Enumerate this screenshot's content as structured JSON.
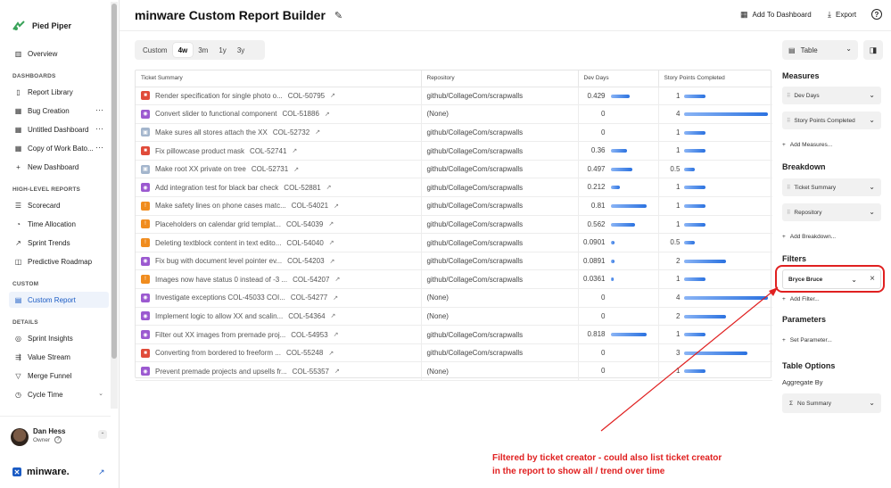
{
  "sidebar": {
    "brand": "Pied Piper",
    "overview": "Overview",
    "sections": {
      "dashboards": "DASHBOARDS",
      "high_level": "HIGH-LEVEL REPORTS",
      "custom": "CUSTOM",
      "details": "DETAILS"
    },
    "dashboards": [
      "Report Library",
      "Bug Creation",
      "Untitled Dashboard",
      "Copy of Work Bato...",
      "New Dashboard"
    ],
    "high_level": [
      "Scorecard",
      "Time Allocation",
      "Sprint Trends",
      "Predictive Roadmap"
    ],
    "custom": [
      "Custom Report"
    ],
    "details": [
      "Sprint Insights",
      "Value Stream",
      "Merge Funnel",
      "Cycle Time"
    ],
    "user": {
      "name": "Dan Hess",
      "role": "Owner"
    },
    "footer_brand": "minware."
  },
  "header": {
    "title": "minware Custom Report Builder",
    "add_dashboard": "Add To Dashboard",
    "export": "Export"
  },
  "periods": [
    "Custom",
    "4w",
    "3m",
    "1y",
    "3y"
  ],
  "active_period": "4w",
  "view_select": "Table",
  "table": {
    "columns": [
      "Ticket Summary",
      "Repository",
      "Dev Days",
      "Story Points Completed"
    ],
    "rows": [
      {
        "type": "bug",
        "summary": "Render specification for single photo o...",
        "key": "COL-50795",
        "repo": "github/CollageCom/scrapwalls",
        "dev": "0.429",
        "dev_v": 0.429,
        "sp": "1",
        "sp_v": 1
      },
      {
        "type": "story",
        "summary": "Convert slider to functional component",
        "key": "COL-51886",
        "repo": "(None)",
        "dev": "0",
        "dev_v": 0,
        "sp": "4",
        "sp_v": 4
      },
      {
        "type": "task",
        "summary": "Make sures all stores attach the XX",
        "key": "COL-52732",
        "repo": "github/CollageCom/scrapwalls",
        "dev": "0",
        "dev_v": 0,
        "sp": "1",
        "sp_v": 1
      },
      {
        "type": "bug",
        "summary": "Fix pillowcase product mask",
        "key": "COL-52741",
        "repo": "github/CollageCom/scrapwalls",
        "dev": "0.36",
        "dev_v": 0.36,
        "sp": "1",
        "sp_v": 1
      },
      {
        "type": "task",
        "summary": "Make root XX private on tree",
        "key": "COL-52731",
        "repo": "github/CollageCom/scrapwalls",
        "dev": "0.497",
        "dev_v": 0.497,
        "sp": "0.5",
        "sp_v": 0.5
      },
      {
        "type": "story",
        "summary": "Add integration test for black bar check",
        "key": "COL-52881",
        "repo": "github/CollageCom/scrapwalls",
        "dev": "0.212",
        "dev_v": 0.212,
        "sp": "1",
        "sp_v": 1
      },
      {
        "type": "warn",
        "summary": "Make safety lines on phone cases matc...",
        "key": "COL-54021",
        "repo": "github/CollageCom/scrapwalls",
        "dev": "0.81",
        "dev_v": 0.81,
        "sp": "1",
        "sp_v": 1
      },
      {
        "type": "warn",
        "summary": "Placeholders on calendar grid templat...",
        "key": "COL-54039",
        "repo": "github/CollageCom/scrapwalls",
        "dev": "0.562",
        "dev_v": 0.562,
        "sp": "1",
        "sp_v": 1
      },
      {
        "type": "warn",
        "summary": "Deleting textblock content in text edito...",
        "key": "COL-54040",
        "repo": "github/CollageCom/scrapwalls",
        "dev": "0.0901",
        "dev_v": 0.0901,
        "sp": "0.5",
        "sp_v": 0.5
      },
      {
        "type": "story",
        "summary": "Fix bug with document level pointer ev...",
        "key": "COL-54203",
        "repo": "github/CollageCom/scrapwalls",
        "dev": "0.0891",
        "dev_v": 0.0891,
        "sp": "2",
        "sp_v": 2
      },
      {
        "type": "warn",
        "summary": "Images now have status 0 instead of -3 ...",
        "key": "COL-54207",
        "repo": "github/CollageCom/scrapwalls",
        "dev": "0.0361",
        "dev_v": 0.0361,
        "sp": "1",
        "sp_v": 1
      },
      {
        "type": "story",
        "summary": "Investigate exceptions COL-45033 COI...",
        "key": "COL-54277",
        "repo": "(None)",
        "dev": "0",
        "dev_v": 0,
        "sp": "4",
        "sp_v": 4
      },
      {
        "type": "story",
        "summary": "Implement logic to allow XX and scalin...",
        "key": "COL-54364",
        "repo": "(None)",
        "dev": "0",
        "dev_v": 0,
        "sp": "2",
        "sp_v": 2
      },
      {
        "type": "story",
        "summary": "Filter out XX images from premade proj...",
        "key": "COL-54953",
        "repo": "github/CollageCom/scrapwalls",
        "dev": "0.818",
        "dev_v": 0.818,
        "sp": "1",
        "sp_v": 1
      },
      {
        "type": "bug",
        "summary": "Converting from bordered to freeform ...",
        "key": "COL-55248",
        "repo": "github/CollageCom/scrapwalls",
        "dev": "0",
        "dev_v": 0,
        "sp": "3",
        "sp_v": 3
      },
      {
        "type": "story",
        "summary": "Prevent premade projects and upsells fr...",
        "key": "COL-55357",
        "repo": "(None)",
        "dev": "0",
        "dev_v": 0,
        "sp": "1",
        "sp_v": 1
      }
    ],
    "dev_max": 0.818,
    "sp_max": 4
  },
  "panel": {
    "measures": "Measures",
    "measure_fields": [
      "Dev Days",
      "Story Points Completed"
    ],
    "add_measures": "Add Measures...",
    "breakdown": "Breakdown",
    "breakdown_fields": [
      "Ticket Summary",
      "Repository"
    ],
    "add_breakdown": "Add Breakdown...",
    "filters": "Filters",
    "filter_value": "Bryce Bruce",
    "add_filter": "Add Filter...",
    "parameters": "Parameters",
    "set_parameter": "Set Parameter...",
    "table_options": "Table Options",
    "aggregate_by": "Aggregate By",
    "aggregate_value": "No Summary"
  },
  "annotation": {
    "line1": "Filtered by ticket creator - could also list ticket creator",
    "line2": "in the report to show all / trend over time"
  },
  "colors": {
    "accent": "#1a5bc4",
    "annotation": "#e02020",
    "bar": "#2b72e0"
  }
}
